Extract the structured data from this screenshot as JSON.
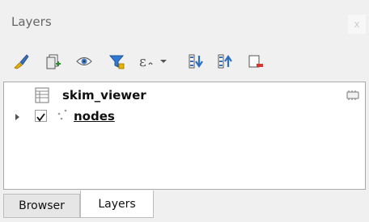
{
  "panel": {
    "title": "Layers",
    "close_label": "x"
  },
  "toolbar": {
    "buttons": [
      {
        "name": "style-manager",
        "icon": "paintbrush-icon"
      },
      {
        "name": "add-group",
        "icon": "add-group-icon"
      },
      {
        "name": "manage-visibility",
        "icon": "eye-icon"
      },
      {
        "name": "filter-legend",
        "icon": "filter-icon"
      },
      {
        "name": "filter-expression",
        "icon": "epsilon-filter-icon"
      },
      {
        "name": "expand-all",
        "icon": "expand-all-icon"
      },
      {
        "name": "collapse-all",
        "icon": "collapse-all-icon"
      },
      {
        "name": "remove-layer",
        "icon": "remove-layer-icon"
      }
    ]
  },
  "layers": [
    {
      "name": "skim_viewer",
      "type": "table",
      "checked": null,
      "expandable": false,
      "underline": false
    },
    {
      "name": "nodes",
      "type": "point",
      "checked": true,
      "expandable": true,
      "underline": true
    }
  ],
  "tabs": [
    {
      "label": "Browser",
      "active": false
    },
    {
      "label": "Layers",
      "active": true
    }
  ],
  "colors": {
    "accent_yellow": "#e8b400",
    "accent_blue": "#3a6fb6",
    "filter_blue": "#2f7ad6",
    "remove_red": "#d9362b"
  }
}
